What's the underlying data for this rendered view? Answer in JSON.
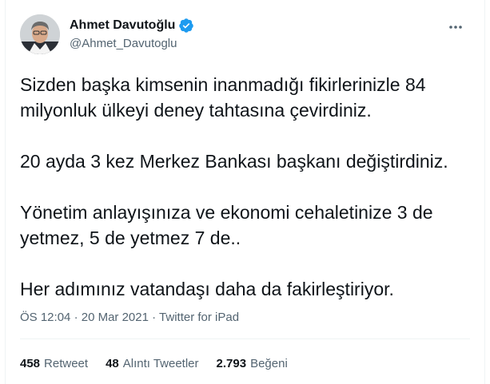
{
  "author": {
    "name": "Ahmet Davutoğlu",
    "handle": "@Ahmet_Davutoglu",
    "verified": true,
    "verified_color": "#1d9bf0"
  },
  "tweet": {
    "paragraphs": [
      "Sizden başka kimsenin inanmadığı fikirlerinizle 84 milyonluk ülkeyi deney tahtasına çevirdiniz.",
      "20 ayda 3 kez Merkez Bankası başkanı değiştirdiniz.",
      "Yönetim anlayışınıza ve ekonomi cehaletinize 3 de yetmez, 5 de yetmez 7 de..",
      "Her adımınız vatandaşı daha da fakirleştiriyor."
    ]
  },
  "meta": {
    "time": "ÖS 12:04",
    "separator": "·",
    "date": "20 Mar 2021",
    "source": "Twitter for iPad"
  },
  "stats": {
    "retweets": {
      "count": "458",
      "label": "Retweet"
    },
    "quotes": {
      "count": "48",
      "label": "Alıntı Tweetler"
    },
    "likes": {
      "count": "2.793",
      "label": "Beğeni"
    }
  }
}
